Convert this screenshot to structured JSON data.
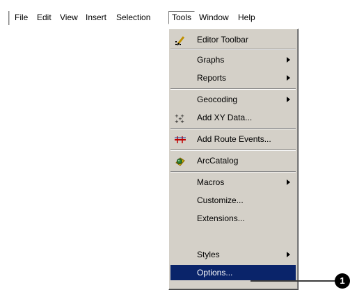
{
  "menubar": {
    "items": [
      "File",
      "Edit",
      "View",
      "Insert",
      "Selection",
      "Tools",
      "Window",
      "Help"
    ]
  },
  "tools_menu": {
    "items": [
      {
        "label": "Editor Toolbar",
        "icon": "editor-pencil-icon"
      },
      {
        "label": "Graphs",
        "submenu": true
      },
      {
        "label": "Reports",
        "submenu": true
      },
      {
        "label": "Geocoding",
        "submenu": true
      },
      {
        "label": "Add XY Data...",
        "icon": "xy-data-icon"
      },
      {
        "label": "Add Route Events...",
        "icon": "route-events-icon"
      },
      {
        "label": "ArcCatalog",
        "icon": "arccatalog-icon"
      },
      {
        "label": "Macros",
        "submenu": true
      },
      {
        "label": "Customize..."
      },
      {
        "label": "Extensions..."
      },
      {
        "label": "Styles",
        "submenu": true
      },
      {
        "label": "Options...",
        "selected": true
      }
    ]
  },
  "callout": {
    "number": "1"
  },
  "colors": {
    "menu_bg": "#d4d0c8",
    "highlight": "#0a246a"
  }
}
